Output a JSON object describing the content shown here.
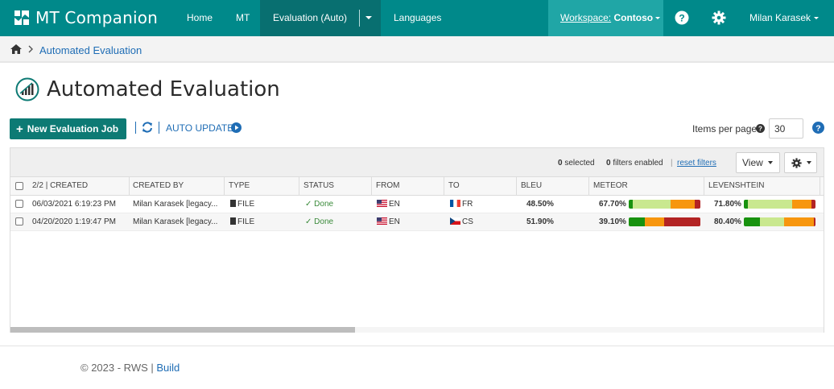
{
  "nav": {
    "brand": "MT Companion",
    "home": "Home",
    "mt": "MT",
    "evaluation": "Evaluation (Auto)",
    "languages": "Languages",
    "workspace_label": "Workspace:",
    "workspace_name": "Contoso",
    "user": "Milan Karasek"
  },
  "breadcrumb": {
    "current": "Automated Evaluation"
  },
  "page": {
    "title": "Automated Evaluation"
  },
  "toolbar": {
    "new_job": "New Evaluation Job",
    "auto_update": "AUTO UPDATE",
    "items_per_page_label": "Items per page",
    "items_per_page_value": "30"
  },
  "grid": {
    "selected_count": "0",
    "selected_label": "selected",
    "filters_count": "0",
    "filters_label": "filters enabled",
    "reset_filters": "reset filters",
    "view_label": "View",
    "columns": {
      "created_count": "2/2",
      "created": "| CREATED",
      "created_by": "CREATED BY",
      "type": "TYPE",
      "status": "STATUS",
      "from": "FROM",
      "to": "TO",
      "bleu": "BLEU",
      "meteor": "METEOR",
      "levenshtein": "LEVENSHTEIN"
    },
    "rows": [
      {
        "created": "06/03/2021 6:19:23 PM",
        "created_by": "Milan Karasek [legacy...",
        "type": "FILE",
        "status": "Done",
        "from": "EN",
        "to": "FR",
        "bleu": "48.50%",
        "meteor": "67.70%",
        "levenshtein": "71.80%",
        "to_flag": "fr"
      },
      {
        "created": "04/20/2020 1:19:47 PM",
        "created_by": "Milan Karasek [legacy...",
        "type": "FILE",
        "status": "Done",
        "from": "EN",
        "to": "CS",
        "bleu": "51.90%",
        "meteor": "39.10%",
        "levenshtein": "80.40%",
        "to_flag": "cz"
      }
    ]
  },
  "colors": {
    "nav_bg": "#00898a",
    "nav_active": "#086f70",
    "workspace_bg": "#20a6a6",
    "primary_button": "#0d7a74",
    "link": "#1f6db5",
    "done": "#3a8a3a",
    "bar_dark_green": "#18920f",
    "bar_light_green": "#c9e88f",
    "bar_orange": "#f7960e",
    "bar_red": "#b32424"
  },
  "footer": {
    "copyright": "© 2023 - RWS |",
    "build": "Build"
  }
}
